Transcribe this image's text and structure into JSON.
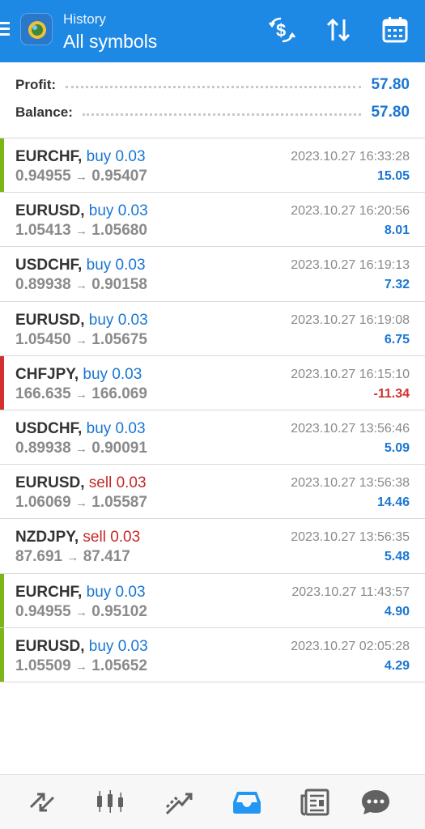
{
  "header": {
    "title_small": "History",
    "title_large": "All symbols",
    "buttons": [
      {
        "name": "currency-exchange-icon",
        "label": "$"
      },
      {
        "name": "sort-icon",
        "label": "⇅"
      },
      {
        "name": "calendar-icon",
        "label": ""
      }
    ]
  },
  "summary": {
    "profit_label": "Profit:",
    "profit_value": "57.80",
    "balance_label": "Balance:",
    "balance_value": "57.80"
  },
  "trades": [
    {
      "symbol": "EURCHF,",
      "side": "buy 0.03",
      "type": "buy",
      "open": "0.94955",
      "close": "0.95407",
      "time": "2023.10.27 16:33:28",
      "profit": "15.05",
      "bar": "#7cb518"
    },
    {
      "symbol": "EURUSD,",
      "side": "buy 0.03",
      "type": "buy",
      "open": "1.05413",
      "close": "1.05680",
      "time": "2023.10.27 16:20:56",
      "profit": "8.01",
      "bar": ""
    },
    {
      "symbol": "USDCHF,",
      "side": "buy 0.03",
      "type": "buy",
      "open": "0.89938",
      "close": "0.90158",
      "time": "2023.10.27 16:19:13",
      "profit": "7.32",
      "bar": ""
    },
    {
      "symbol": "EURUSD,",
      "side": "buy 0.03",
      "type": "buy",
      "open": "1.05450",
      "close": "1.05675",
      "time": "2023.10.27 16:19:08",
      "profit": "6.75",
      "bar": ""
    },
    {
      "symbol": "CHFJPY,",
      "side": "buy 0.03",
      "type": "buy",
      "open": "166.635",
      "close": "166.069",
      "time": "2023.10.27 16:15:10",
      "profit": "-11.34",
      "bar": "#d32f2f"
    },
    {
      "symbol": "USDCHF,",
      "side": "buy 0.03",
      "type": "buy",
      "open": "0.89938",
      "close": "0.90091",
      "time": "2023.10.27 13:56:46",
      "profit": "5.09",
      "bar": ""
    },
    {
      "symbol": "EURUSD,",
      "side": "sell 0.03",
      "type": "sell",
      "open": "1.06069",
      "close": "1.05587",
      "time": "2023.10.27 13:56:38",
      "profit": "14.46",
      "bar": ""
    },
    {
      "symbol": "NZDJPY,",
      "side": "sell 0.03",
      "type": "sell",
      "open": "87.691",
      "close": "87.417",
      "time": "2023.10.27 13:56:35",
      "profit": "5.48",
      "bar": ""
    },
    {
      "symbol": "EURCHF,",
      "side": "buy 0.03",
      "type": "buy",
      "open": "0.94955",
      "close": "0.95102",
      "time": "2023.10.27 11:43:57",
      "profit": "4.90",
      "bar": "#7cb518"
    },
    {
      "symbol": "EURUSD,",
      "side": "buy 0.03",
      "type": "buy",
      "open": "1.05509",
      "close": "1.05652",
      "time": "2023.10.27 02:05:28",
      "profit": "4.29",
      "bar": "#7cb518"
    }
  ],
  "arrow": "→",
  "colors": {
    "accent": "#1e88e5",
    "buy": "#1976d2",
    "sell": "#c62828",
    "profit_positive": "#1976d2",
    "profit_negative": "#d32f2f",
    "nav_active": "#2196f3",
    "nav_inactive": "#616161"
  },
  "bottom_nav": [
    {
      "name": "nav-quotes-icon",
      "active": false
    },
    {
      "name": "nav-chart-icon",
      "active": false
    },
    {
      "name": "nav-trade-icon",
      "active": false
    },
    {
      "name": "nav-history-icon",
      "active": true
    },
    {
      "name": "nav-news-icon",
      "active": false
    },
    {
      "name": "nav-messages-icon",
      "active": false
    }
  ]
}
